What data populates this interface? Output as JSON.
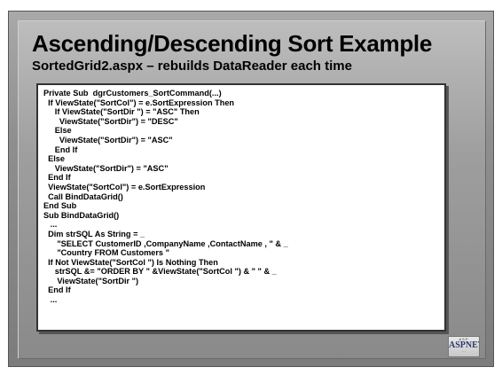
{
  "slide": {
    "title": "Ascending/Descending Sort Example",
    "subtitle": "SortedGrid2.aspx – rebuilds DataReader each time",
    "code_lines": [
      "Private Sub  dgrCustomers_SortCommand(...)",
      "  If ViewState(\"SortCol\") = e.SortExpression Then",
      "     If ViewState(\"SortDir \") = \"ASC\" Then",
      "       ViewState(\"SortDir\") = \"DESC\"",
      "     Else",
      "       ViewState(\"SortDir\") = \"ASC\"",
      "     End If",
      "  Else",
      "     ViewState(\"SortDir\") = \"ASC\"",
      "  End If",
      "  ViewState(\"SortCol\") = e.SortExpression",
      "  Call BindDataGrid()",
      "End Sub",
      "Sub BindDataGrid()",
      "   ...",
      "  Dim strSQL As String = _",
      "      \"SELECT CustomerID ,CompanyName ,ContactName , \" & _",
      "      \"Country FROM Customers \"",
      "  If Not ViewState(\"SortCol \") Is Nothing Then",
      "     strSQL &= \"ORDER BY \" &ViewState(\"SortCol \") & \" \" & _",
      "      ViewState(\"SortDir \")",
      "  End If",
      "   ..."
    ],
    "logo": {
      "top": "ASP",
      "main": "ASPNET",
      "bottom": "···"
    }
  }
}
